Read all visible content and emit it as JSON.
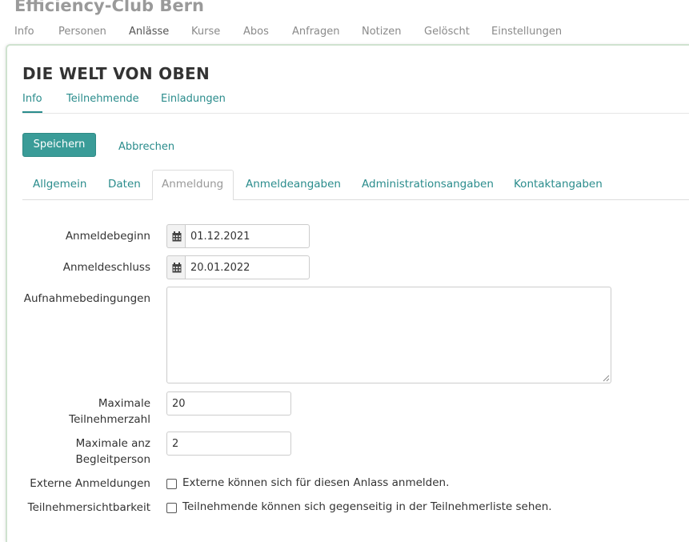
{
  "org": {
    "title": "Efficiency-Club Bern"
  },
  "top_nav": [
    "Info",
    "Personen",
    "Anlässe",
    "Kurse",
    "Abos",
    "Anfragen",
    "Notizen",
    "Gelöscht",
    "Einstellungen"
  ],
  "top_nav_active": "Anlässe",
  "page": {
    "title": "DIE WELT VON OBEN"
  },
  "subnav": [
    "Info",
    "Teilnehmende",
    "Einladungen"
  ],
  "subnav_active": "Info",
  "actions": {
    "save": "Speichern",
    "cancel": "Abbrechen"
  },
  "tabs": [
    "Allgemein",
    "Daten",
    "Anmeldung",
    "Anmeldeangaben",
    "Administrationsangaben",
    "Kontaktangaben"
  ],
  "tabs_active": "Anmeldung",
  "form": {
    "start_label": "Anmeldebeginn",
    "start_value": "01.12.2021",
    "end_label": "Anmeldeschluss",
    "end_value": "20.01.2022",
    "conditions_label": "Aufnahmebedingungen",
    "conditions_value": "",
    "max_participants_label_1": "Maximale",
    "max_participants_label_2": "Teilnehmerzahl",
    "max_participants_value": "20",
    "max_companions_label_1": "Maximale anz",
    "max_companions_label_2": "Begleitperson",
    "max_companions_value": "2",
    "external_label": "Externe Anmeldungen",
    "external_text": "Externe können sich für diesen Anlass anmelden.",
    "external_checked": false,
    "visibility_label": "Teilnehmersichtbarkeit",
    "visibility_text": "Teilnehmende können sich gegenseitig in der Teilnehmerliste sehen.",
    "visibility_checked": false
  },
  "colors": {
    "accent": "#2a8c8c",
    "button": "#3a9c98"
  },
  "icons": {
    "date": "calendar-icon",
    "resize": "resize-grip-icon"
  }
}
